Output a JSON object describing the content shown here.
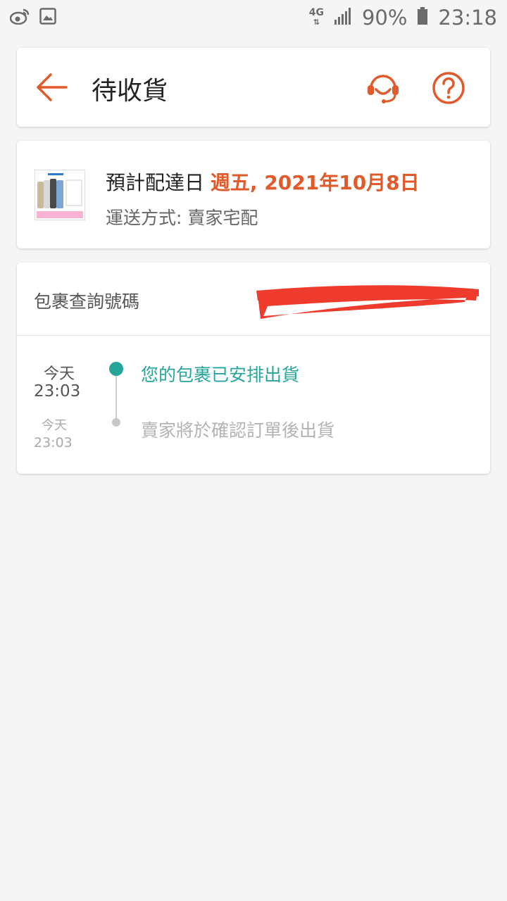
{
  "status_bar": {
    "network": "4G",
    "battery": "90%",
    "time": "23:18",
    "icons": [
      "weibo-icon",
      "image-icon",
      "signal-icon",
      "battery-icon"
    ]
  },
  "header": {
    "title": "待收貨",
    "back_icon": "arrow-left-icon",
    "support_icon": "headset-icon",
    "help_icon": "question-circle-icon"
  },
  "delivery": {
    "estimate_label": "預計配達日 ",
    "estimate_date": "週五, 2021年10月8日",
    "shipping_method": "運送方式: 賣家宅配"
  },
  "tracking": {
    "label": "包裹查詢號碼",
    "events": [
      {
        "day": "今天",
        "time": "23:03",
        "text": "您的包裹已安排出貨",
        "active": true
      },
      {
        "day": "今天",
        "time": "23:03",
        "text": "賣家將於確認訂單後出貨",
        "active": false
      }
    ]
  },
  "colors": {
    "accent": "#e05a2b",
    "teal": "#26a69a",
    "background": "#f5f5f5",
    "redaction": "#ef3b2d"
  }
}
